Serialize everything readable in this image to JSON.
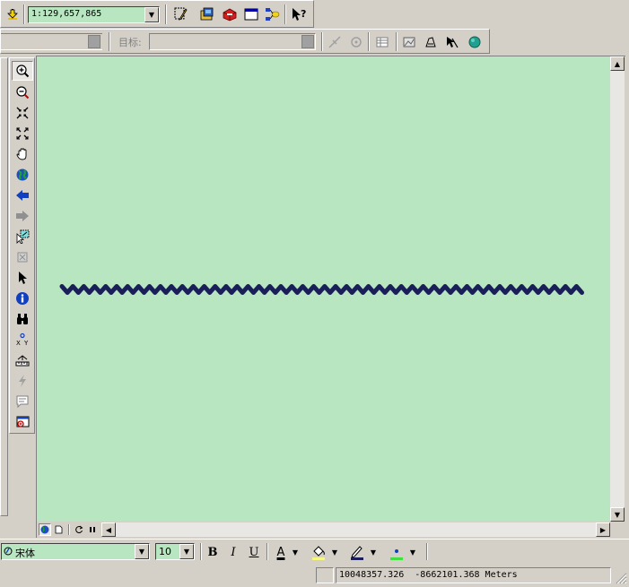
{
  "toolbar_top": {
    "scale_value": "1:129,657,865",
    "buttons": [
      "add-data-icon",
      "editor-icon",
      "arccatalog-icon",
      "arctoolbox-icon",
      "command-line-icon",
      "model-builder-icon",
      "whats-this-icon"
    ]
  },
  "toolbar_edit": {
    "target_label": "目标:"
  },
  "drawing_toolbar": {
    "font_value": "宋体",
    "size_value": "10",
    "bold_label": "B",
    "italic_label": "I",
    "underline_label": "U",
    "font_color_label": "A"
  },
  "status_bar": {
    "coords": "10048357.326  -8662101.368 Meters"
  },
  "colors": {
    "map_background": "#b7e6c0",
    "line_color": "#1a1f5a"
  }
}
